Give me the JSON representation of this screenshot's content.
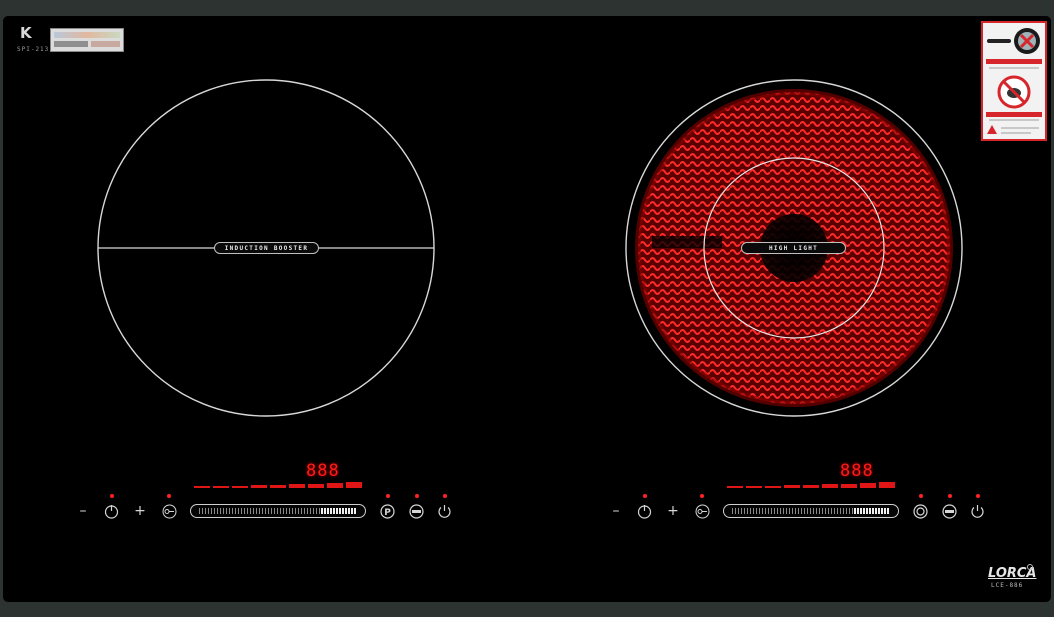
{
  "brand": {
    "mark": "K",
    "model": "SPI-213"
  },
  "left_zone": {
    "label": "INDUCTION BOOSTER",
    "display": "888",
    "minus": "–",
    "plus": "+",
    "power_level_fraction": 1.0
  },
  "right_zone": {
    "label": "HIGH LIGHT",
    "display": "888",
    "minus": "–",
    "plus": "+",
    "power_level_fraction": 1.0
  },
  "footer_logo": {
    "name": "LORCA",
    "model": "LCE-886"
  },
  "icons": [
    "timer-icon",
    "key-lock-icon",
    "pause-p-icon",
    "booster-icon",
    "power-icon",
    "dual-ring-icon",
    "pan-size-icon",
    "no-touch-icon",
    "warning-triangle-icon"
  ],
  "colors": {
    "glass": "#000000",
    "heat": "#e01515",
    "display": "#ff1a1a",
    "frame": "#2c3331"
  }
}
